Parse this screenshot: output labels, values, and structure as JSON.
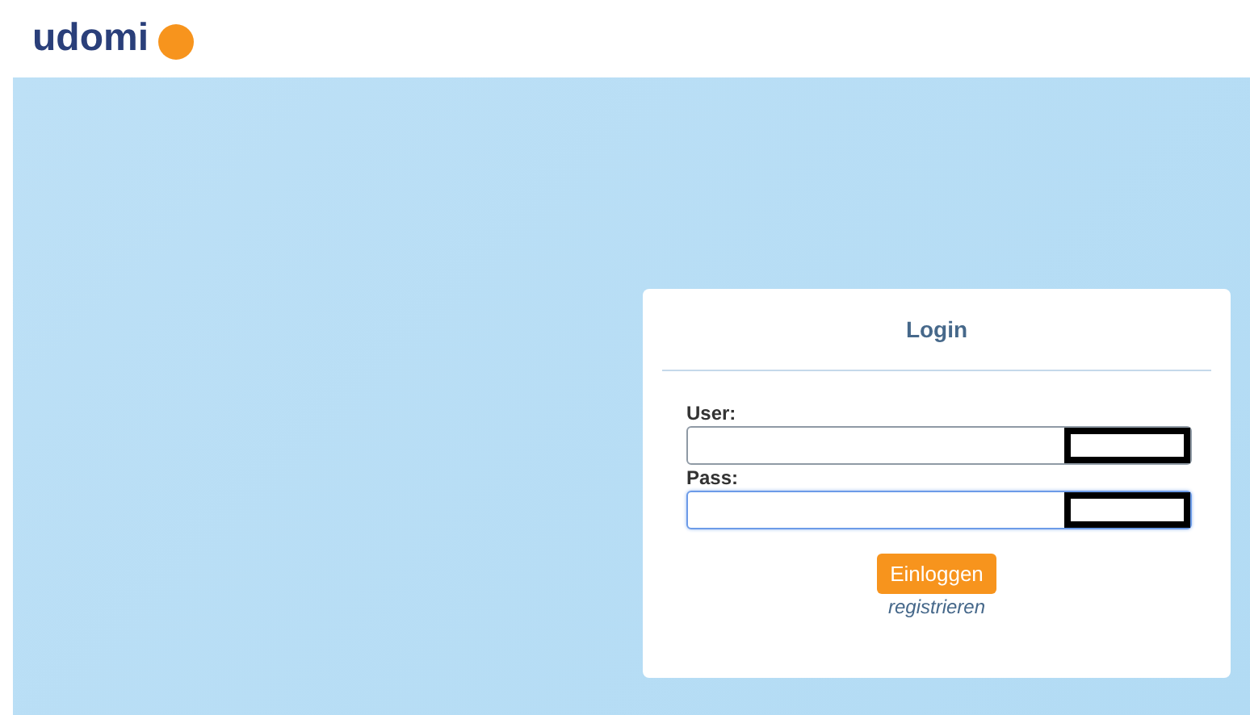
{
  "logo": {
    "text": "udomi"
  },
  "login": {
    "title": "Login",
    "fields": [
      {
        "label": "User:",
        "focused": false,
        "redacted": true
      },
      {
        "label": "Pass:",
        "focused": true,
        "redacted": true
      }
    ],
    "button": "Einloggen",
    "link": "registrieren"
  }
}
